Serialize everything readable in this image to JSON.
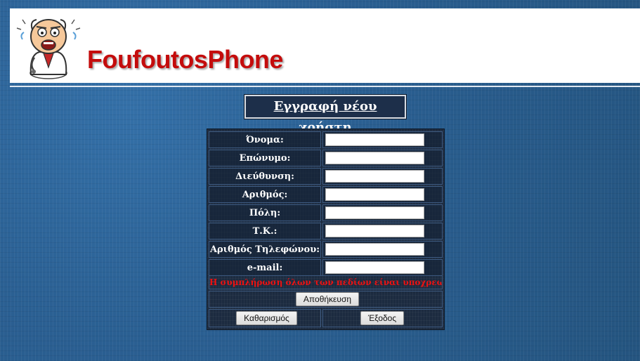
{
  "header": {
    "logo_text": "FoufoutosPhone"
  },
  "title": "Εγγραφή νέου χρήστη",
  "form": {
    "fields": [
      {
        "label": "Όνομα:",
        "value": ""
      },
      {
        "label": "Επώνυμο:",
        "value": ""
      },
      {
        "label": "Διεύθυνση:",
        "value": ""
      },
      {
        "label": "Αριθμός:",
        "value": ""
      },
      {
        "label": "Πόλη:",
        "value": ""
      },
      {
        "label": "Τ.Κ.:",
        "value": ""
      },
      {
        "label": "Αριθμός Τηλεφώνου:",
        "value": ""
      },
      {
        "label": "e-mail:",
        "value": ""
      }
    ],
    "warning": "Η συμπλήρωση όλων των πεδίων είναι υποχρεωτική",
    "save_label": "Αποθήκευση",
    "clear_label": "Καθαρισμός",
    "exit_label": "Έξοδος"
  },
  "colors": {
    "background": "#2a5f92",
    "logo_text": "#c40c0c",
    "warning": "#ee1111"
  }
}
